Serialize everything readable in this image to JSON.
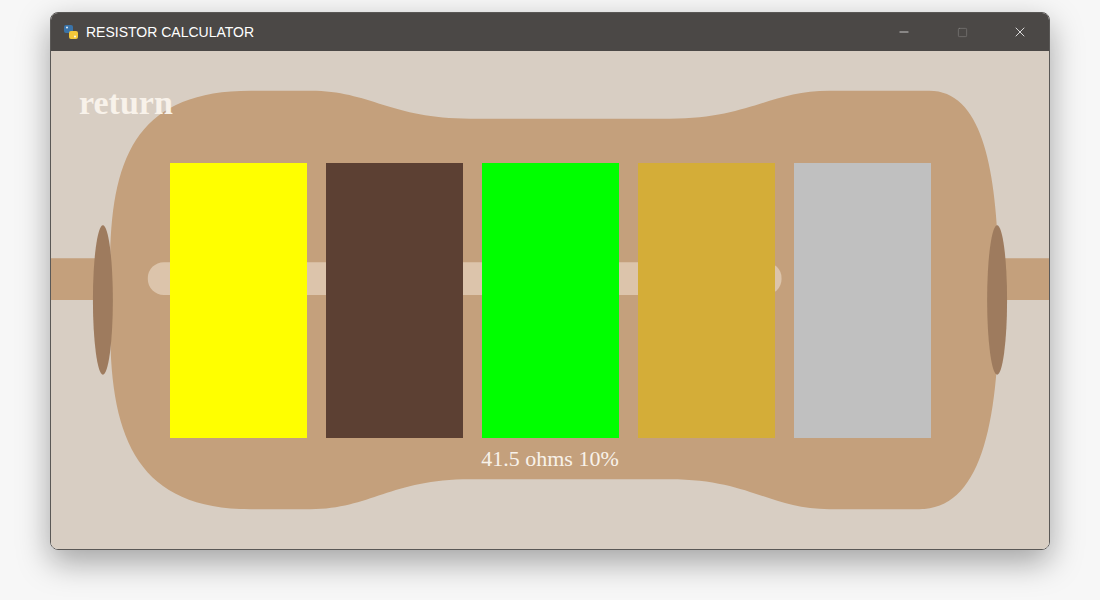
{
  "window": {
    "title": "RESISTOR CALCULATOR",
    "maximize_disabled": true
  },
  "return_button": {
    "label": "return"
  },
  "bands": [
    {
      "color": "#ffff00"
    },
    {
      "color": "#5c4033"
    },
    {
      "color": "#00ff00"
    },
    {
      "color": "#d4ad38"
    },
    {
      "color": "#c0c0c0"
    }
  ],
  "result": "41.5 ohms 10%"
}
